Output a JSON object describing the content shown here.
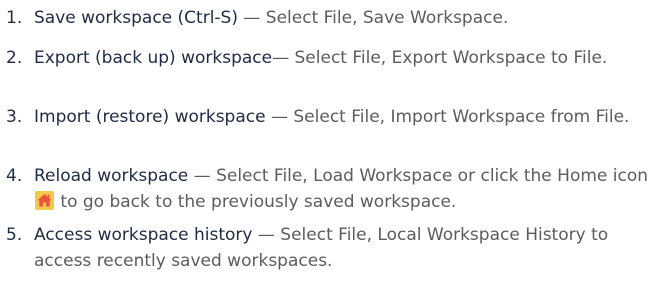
{
  "steps": [
    {
      "number": "1.",
      "term": "Save workspace (Ctrl-S)",
      "desc": " — Select File, Save Workspace."
    },
    {
      "number": "2.",
      "term": "Export (back up) workspace",
      "desc": "— Select File, Export Workspace to File."
    },
    {
      "number": "3.",
      "term": "Import (restore) workspace",
      "desc": " — Select File, Import Workspace from File."
    },
    {
      "number": "4.",
      "term": "Reload workspace",
      "desc_before_icon": " — Select File, Load Workspace or click the Home icon ",
      "icon": "home-icon",
      "desc_after_icon": " to go back to the previously saved workspace."
    },
    {
      "number": "5.",
      "term": "Access workspace history",
      "desc": " — Select File, Local Workspace History to access recently saved workspaces."
    }
  ],
  "colors": {
    "term": "#1f2a44",
    "desc": "#5b5c5e",
    "icon_bg": "#f2c94c",
    "icon_house": "#e8553d"
  }
}
